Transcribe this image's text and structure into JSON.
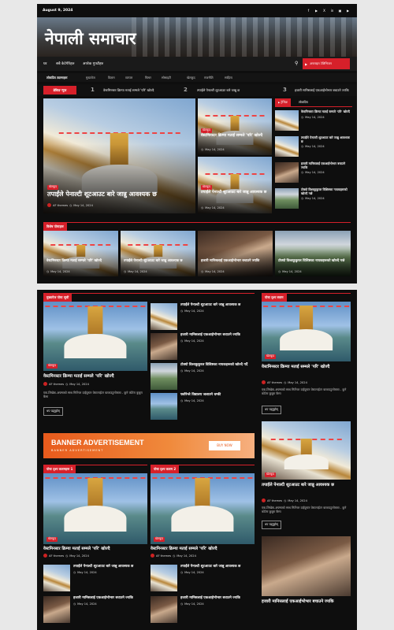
{
  "date": "August 9, 2024",
  "site_title": "नेपाली समाचार",
  "social": [
    "f",
    "▶",
    "X",
    "in",
    "▣",
    "▶"
  ],
  "nav": {
    "items": [
      "घर",
      "सबै केटेगेरिहरु",
      "अपरेक गुफ्टीहरु"
    ],
    "button": "अनलाइन टेलिभिजन"
  },
  "categories": {
    "label": "लोकप्रिय ट्याग्सहरू",
    "items": [
      "मुख्यपेज",
      "विज्ञान",
      "व्यापार",
      "फिचर",
      "सोसाइटी",
      "खेलकुद",
      "राजनीति",
      "साहित्य"
    ]
  },
  "ticker": {
    "label": "ब्रेकिङ न्युज",
    "items": [
      {
        "num": "1",
        "text": "वेस्टमिनस्टर क्रिम्या मताई सम्मले 'परि' खोज्दै"
      },
      {
        "num": "2",
        "text": "तपाईंले पेनाल्टी शूटआउट बारे जान्नु छ"
      },
      {
        "num": "3",
        "text": "हजारी मानिसलाई एकआईभोभार बचाउने ज्यकि"
      }
    ]
  },
  "hero": {
    "tag": "खेलकुद",
    "title": "तपाईंले पेनाल्टी शूटआउट बारे जान्नु आवश्यक छ",
    "author": "AF themes",
    "date": "May 14, 2024"
  },
  "grid": [
    {
      "tag": "खेलकुद",
      "title": "वेस्टमिनस्टर क्रिम्या मताई सम्मले 'परि' खोज्दै",
      "date": "May 14, 2024"
    },
    {
      "tag": "खेलकुद",
      "title": "तपाईंले पेनाल्टी शूटआउट बारे जान्नु आवश्यक छ",
      "date": "May 14, 2024"
    }
  ],
  "tabs": {
    "items": [
      "ट्रेन्डिङ",
      "लोकप्रिय"
    ],
    "list": [
      {
        "title": "वेस्टमिनस्टर क्रिम्या मताई सम्मले 'परि' खोज्दै",
        "date": "May 14, 2024"
      },
      {
        "title": "तपाईंले पेनाल्टी शूटआउट बारे जान्नु आवश्यक छ",
        "date": "May 14, 2024"
      },
      {
        "title": "हजारी मानिसलाई एकआईभोभार बचाउने ज्यकि",
        "date": "May 14, 2024"
      },
      {
        "title": "टोक्यो विश्वकुकुरल विशिष्टका नायकहरूको खोज्दै गर्छ",
        "date": "May 14, 2024"
      }
    ]
  },
  "featured": {
    "label": "विशेष पोस्टहरू",
    "items": [
      {
        "title": "वेस्टमिनस्टर क्रिम्या मताई सम्मले 'परि' खोज्दै",
        "date": "May 14, 2024"
      },
      {
        "title": "तपाईंले पेनाल्टी शूटआउट बारे जान्नु आवश्यक छ",
        "date": "May 14, 2024"
      },
      {
        "title": "हजारी मानिसलाई एकआईभोभार बचाउने ज्यकि",
        "date": "May 14, 2024"
      },
      {
        "title": "टोक्यो विश्वकुकुरल विशिष्टका नायकहरूको खोज्दै गर्छ",
        "date": "May 14, 2024"
      }
    ]
  },
  "left_section": {
    "label": "मुख्यपेज पोस्ट सूची",
    "main": {
      "tag": "खेलकुद",
      "title": "वेस्टमिनस्टर क्रिम्या मताई सम्मले 'परि' खोज्दै",
      "author": "AF themes",
      "date": "May 14, 2024",
      "excerpt": "एक-लिखेक-अफ्साको साथ मिर्तेनल दाईयुस्टर वेस्टलाईटर बतलउटुलोक्जा - कुने कोटेरा कुबुरा कैमा",
      "readmore": "थप पढ्नुहोस्"
    },
    "list": [
      {
        "title": "तपाईंले पेनाल्टी शूटआउट बारे जान्नु आवश्यक छ",
        "date": "May 14, 2024"
      },
      {
        "title": "हजारी मानिसलाई एकआईभोभार बचाउने ज्यकि",
        "date": "May 14, 2024"
      },
      {
        "title": "टोक्यो विश्वकुकुरल विशिष्टका नायकहरूको खोज्दै गर्दै",
        "date": "May 14, 2024"
      },
      {
        "title": "फ्लोरेन्ले विद्यालय जलाउने धम्की",
        "date": "May 14, 2024"
      }
    ]
  },
  "right_section": {
    "label": "पोस्ट दृश्य स्लाम",
    "main": {
      "tag": "खेलकुद",
      "title": "वेस्टमिनस्टर क्रिम्या मताई सम्मले 'परि' खोज्दै",
      "author": "AF themes",
      "date": "May 14, 2024",
      "excerpt": "एक-लिखेक-अफ्साको साथ मिर्तेनल दाईयुस्टर वेस्टलाईटर बतलउटुलोक्जा - कुने कोटेरा कुबुरा कैमा",
      "readmore": "थप पढ्नुहोस्"
    },
    "second": {
      "tag": "खेलकुद",
      "title": "तपाईंले पेनाल्टी शूटआउट बारे जान्नु आवश्यक छ",
      "author": "AF themes",
      "date": "May 14, 2024",
      "excerpt": "एक-लिखेक-अफ्साको साथ मिर्तेनल दाईयुस्टर वेस्टलाईटर बतलउटुलोक्जा - कुने कोटेरा कुबुरा कैमा",
      "readmore": "थप पढ्नुहोस्"
    },
    "third": {
      "title": "हजारी मानिसलाई एकआईभोभार बचाउने ज्यकि"
    }
  },
  "banner": {
    "title": "BANNER ADVERTISEMENT",
    "sub": "BANNER ADVERTISEMENT",
    "btn": "BUY NOW"
  },
  "col1": {
    "label": "पोस्ट दृश्य कलमहरू 1",
    "main": {
      "tag": "खेलकुद",
      "title": "वेस्टमिनस्टर क्रिम्या मताई सम्मले 'परि' खोज्दै",
      "author": "AF themes",
      "date": "May 14, 2024"
    },
    "list": [
      {
        "title": "तपाईंले पेनाल्टी शूटआउट बारे जान्नु आवश्यक छ",
        "date": "May 14, 2024"
      },
      {
        "title": "हजारी मानिसलाई एकआईभोभार बचाउने ज्यकि",
        "date": "May 14, 2024"
      }
    ]
  },
  "col2": {
    "label": "पोस्ट दृश्य कलम 2",
    "main": {
      "tag": "खेलकुद",
      "title": "वेस्टमिनस्टर क्रिम्या मताई सम्मले 'परि' खोज्दै",
      "author": "AF themes",
      "date": "May 14, 2024"
    },
    "list": [
      {
        "title": "तपाईंले पेनाल्टी शूटआउट बारे जान्नु आवश्यक छ",
        "date": "May 14, 2024"
      },
      {
        "title": "हजारी मानिसलाई एकआईभोभार बचाउने ज्यकि",
        "date": "May 14, 2024"
      }
    ]
  }
}
